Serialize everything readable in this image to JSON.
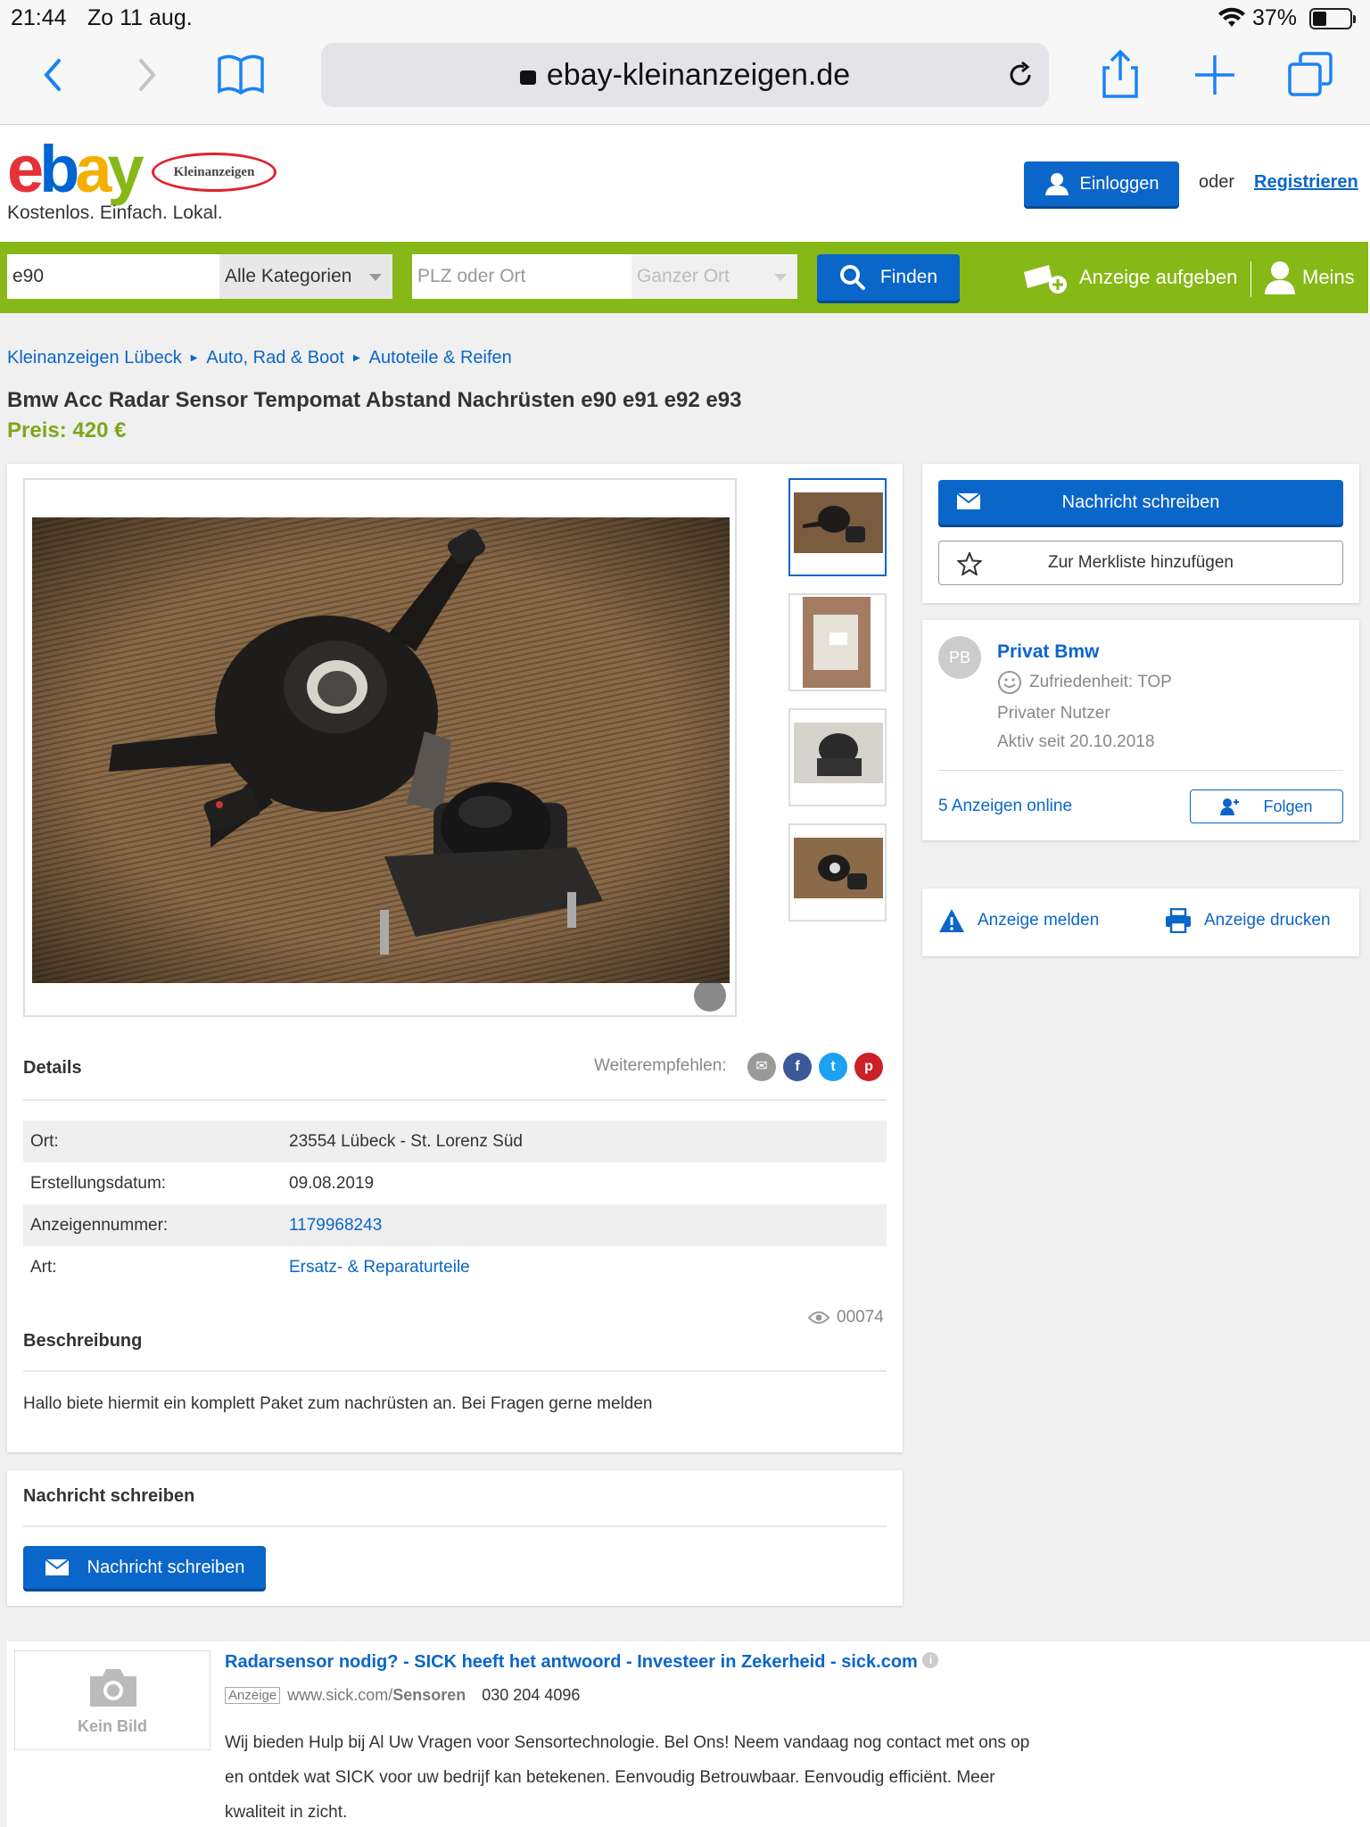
{
  "status_bar": {
    "time": "21:44",
    "date": "Zo 11 aug.",
    "battery": "37%"
  },
  "browser": {
    "url": "ebay-kleinanzeigen.de"
  },
  "header": {
    "tagline": "Kostenlos. Einfach. Lokal.",
    "login_label": "Einloggen",
    "or_label": "oder",
    "register_label": "Registrieren",
    "logo_sub": "Kleinanzeigen"
  },
  "search": {
    "query": "e90",
    "category": "Alle Kategorien",
    "location_placeholder": "PLZ oder Ort",
    "radius": "Ganzer Ort",
    "find_label": "Finden",
    "post_ad_label": "Anzeige aufgeben",
    "meins_label": "Meins"
  },
  "breadcrumbs": [
    "Kleinanzeigen Lübeck",
    "Auto, Rad & Boot",
    "Autoteile & Reifen"
  ],
  "listing": {
    "title": "Bmw Acc Radar Sensor Tempomat Abstand Nachrüsten e90 e91 e92 e93",
    "price": "Preis: 420 €",
    "details_heading": "Details",
    "share_label": "Weiterempfehlen:",
    "details": [
      {
        "key": "Ort:",
        "value": "23554 Lübeck - St. Lorenz Süd"
      },
      {
        "key": "Erstellungsdatum:",
        "value": "09.08.2019"
      },
      {
        "key": "Anzeigennummer:",
        "value": "1179968243"
      },
      {
        "key": "Art:",
        "value": "Ersatz- & Reparaturteile"
      }
    ],
    "views": "00074",
    "description_heading": "Beschreibung",
    "description": "Hallo biete hiermit ein komplett Paket zum nachrüsten an. Bei Fragen gerne melden"
  },
  "message_section": {
    "heading": "Nachricht schreiben",
    "button": "Nachricht schreiben"
  },
  "sidebar": {
    "message_button": "Nachricht schreiben",
    "watchlist_button": "Zur Merkliste hinzufügen",
    "seller": {
      "initials": "PB",
      "name": "Privat Bmw",
      "satisfaction": "Zufriedenheit: TOP",
      "type": "Privater Nutzer",
      "since": "Aktiv seit 20.10.2018",
      "ads_online": "5 Anzeigen online",
      "follow_label": "Folgen"
    },
    "report_label": "Anzeige melden",
    "print_label": "Anzeige drucken"
  },
  "ad": {
    "no_image": "Kein Bild",
    "title": "Radarsensor nodig? - SICK heeft het antwoord - Investeer in Zekerheid - sick.com",
    "badge": "Anzeige",
    "url_prefix": "www.sick.com/",
    "url_bold": "Sensoren",
    "phone": "030 204 4096",
    "text": "Wij bieden Hulp bij Al Uw Vragen voor Sensortechnologie. Bel Ons! Neem vandaag nog contact met ons op en ontdek wat SICK voor uw bedrijf kan betekenen. Eenvoudig Betrouwbaar. Eenvoudig efficiënt. Meer kwaliteit in zicht."
  },
  "colors": {
    "blue": "#0a66c9",
    "green": "#86b817",
    "price": "#7ca818"
  }
}
